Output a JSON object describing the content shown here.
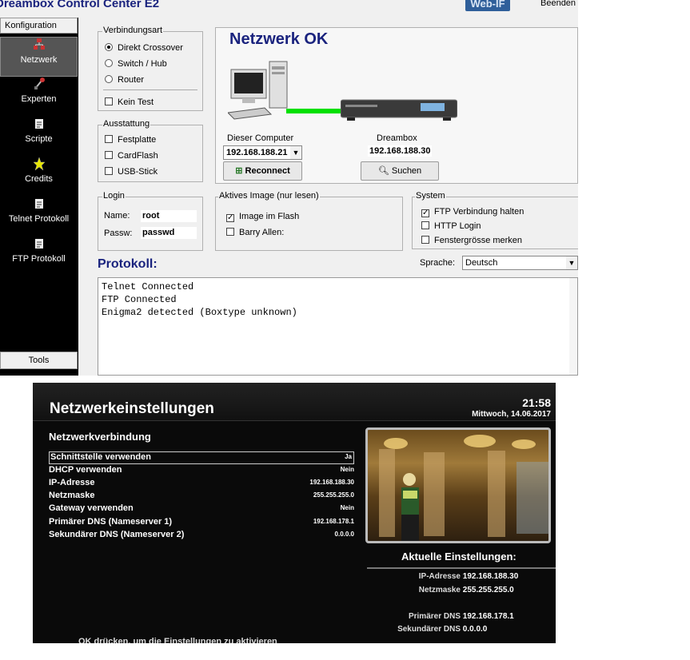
{
  "app": {
    "title": "Dreambox Control Center E2",
    "webif_label": "Web-IF",
    "quit_label": "Beenden"
  },
  "sidebar": {
    "header": "Konfiguration",
    "items": [
      {
        "label": "Netzwerk",
        "icon": "network-icon",
        "active": true
      },
      {
        "label": "Experten",
        "icon": "tools-icon",
        "active": false
      },
      {
        "label": "Scripte",
        "icon": "document-icon",
        "active": false
      },
      {
        "label": "Credits",
        "icon": "star-icon",
        "active": false
      },
      {
        "label": "Telnet Protokoll",
        "icon": "document-icon",
        "active": false
      },
      {
        "label": "FTP Protokoll",
        "icon": "document-icon",
        "active": false
      }
    ],
    "footer": "Tools"
  },
  "connection": {
    "label": "Verbindungsart",
    "options": [
      {
        "label": "Direkt Crossover",
        "selected": true
      },
      {
        "label": "Switch / Hub",
        "selected": false
      },
      {
        "label": "Router",
        "selected": false
      }
    ],
    "no_test": {
      "label": "Kein Test",
      "checked": false
    }
  },
  "equipment": {
    "label": "Ausstattung",
    "items": [
      {
        "label": "Festplatte",
        "checked": false
      },
      {
        "label": "CardFlash",
        "checked": false
      },
      {
        "label": "USB-Stick",
        "checked": false
      }
    ]
  },
  "network": {
    "status": "Netzwerk OK",
    "this_computer_label": "Dieser Computer",
    "this_computer_ip": "192.168.188.21",
    "dreambox_label": "Dreambox",
    "dreambox_ip": "192.168.188.30",
    "reconnect_label": "Reconnect",
    "search_label": "Suchen",
    "link_color": "#00e000"
  },
  "login": {
    "label": "Login",
    "name_label": "Name:",
    "name_value": "root",
    "pass_label": "Passw:",
    "pass_value": "passwd"
  },
  "image": {
    "label": "Aktives Image (nur lesen)",
    "items": [
      {
        "label": "Image im Flash",
        "checked": true
      },
      {
        "label": "Barry Allen:",
        "checked": false
      }
    ]
  },
  "system": {
    "label": "System",
    "items": [
      {
        "label": "FTP Verbindung halten",
        "checked": true
      },
      {
        "label": "HTTP Login",
        "checked": false
      },
      {
        "label": "Fenstergrösse merken",
        "checked": false
      }
    ],
    "language_label": "Sprache:",
    "language_value": "Deutsch"
  },
  "protocol": {
    "title": "Protokoll:",
    "lines": [
      "Telnet Connected",
      "FTP Connected",
      "Enigma2 detected (Boxtype unknown)"
    ]
  },
  "tv": {
    "title": "Netzwerkeinstellungen",
    "time": "21:58",
    "date": "Mittwoch, 14.06.2017",
    "section": "Netzwerkverbindung",
    "rows": [
      {
        "key": "Schnittstelle verwenden",
        "value": "Ja",
        "selected": true
      },
      {
        "key": "DHCP verwenden",
        "value": "Nein",
        "selected": false
      },
      {
        "key": "IP-Adresse",
        "value": "192.168.188.30",
        "selected": false
      },
      {
        "key": "Netzmaske",
        "value": "255.255.255.0",
        "selected": false
      },
      {
        "key": "Gateway verwenden",
        "value": "Nein",
        "selected": false
      },
      {
        "key": "Primärer DNS (Nameserver 1)",
        "value": "192.168.178.1",
        "selected": false
      },
      {
        "key": "Sekundärer DNS (Nameserver 2)",
        "value": "0.0.0.0",
        "selected": false
      }
    ],
    "current_title": "Aktuelle Einstellungen:",
    "current": [
      {
        "key": "IP-Adresse",
        "value": "192.168.188.30"
      },
      {
        "key": "Netzmaske",
        "value": "255.255.255.0"
      },
      {
        "key": "Primärer DNS",
        "value": "192.168.178.1"
      },
      {
        "key": "Sekundärer DNS",
        "value": "0.0.0.0"
      }
    ],
    "footer": "OK drücken, um die Einstellungen zu aktivieren"
  }
}
